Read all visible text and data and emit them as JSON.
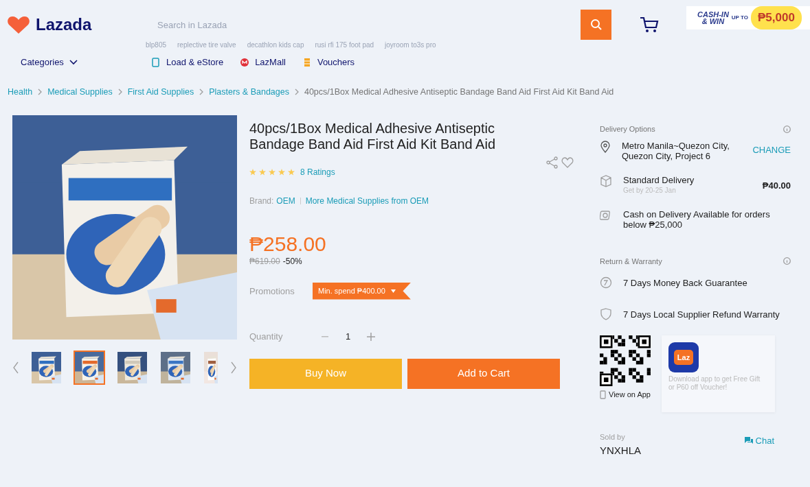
{
  "header": {
    "logo": "Lazada",
    "search": {
      "placeholder": "Search in Lazada"
    },
    "suggestions": [
      "blp805",
      "replective tire valve",
      "decathlon kids cap",
      "rusi rfi 175 foot pad",
      "joyroom to3s pro"
    ],
    "promo": {
      "line1": "CASH-IN",
      "line2": "& WIN",
      "up_to": "UP TO",
      "amount": "₱5,000"
    }
  },
  "nav": {
    "categories": "Categories",
    "links": [
      {
        "label": "Load & eStore",
        "kind": "load"
      },
      {
        "label": "LazMall",
        "kind": "mall"
      },
      {
        "label": "Vouchers",
        "kind": "voucher"
      }
    ]
  },
  "breadcrumb": [
    {
      "label": "Health",
      "link": true
    },
    {
      "label": "Medical Supplies",
      "link": true
    },
    {
      "label": "First Aid Supplies",
      "link": true
    },
    {
      "label": "Plasters & Bandages",
      "link": true
    },
    {
      "label": "40pcs/1Box Medical Adhesive Antiseptic Bandage Band Aid First Aid Kit Band Aid",
      "link": false
    }
  ],
  "gallery": {
    "thumbnails": [
      {
        "selected": false
      },
      {
        "selected": true
      },
      {
        "selected": false
      },
      {
        "selected": false
      },
      {
        "selected": false
      }
    ]
  },
  "product": {
    "title": "40pcs/1Box Medical Adhesive Antiseptic Bandage Band Aid First Aid Kit Band Aid",
    "stars": 5,
    "ratings": "8 Ratings",
    "brand_label": "Brand:",
    "brand": "OEM",
    "more_link": "More Medical Supplies from OEM",
    "price": "₱258.00",
    "original_price": "₱619.00",
    "discount": "-50%",
    "promotions_label": "Promotions",
    "promotion": "Min. spend ₱400.00",
    "quantity_label": "Quantity",
    "quantity": "1",
    "buttons": [
      {
        "label": "Buy Now",
        "kind": "buy"
      },
      {
        "label": "Add to Cart",
        "kind": "cart"
      }
    ]
  },
  "delivery": {
    "title": "Delivery Options",
    "address": "Metro Manila~Quezon City, Quezon City, Project 6",
    "change": "CHANGE",
    "options": [
      {
        "kind": "standard",
        "title": "Standard Delivery",
        "subtitle": "Get by 20-25 Jan",
        "price": "₱40.00"
      },
      {
        "kind": "cod",
        "title": "Cash on Delivery Available for orders below ₱25,000"
      }
    ]
  },
  "warranty": {
    "title": "Return & Warranty",
    "items": [
      {
        "kind": "return",
        "label": "7 Days Money Back Guarantee"
      },
      {
        "kind": "warranty",
        "label": "7 Days Local Supplier Refund Warranty"
      }
    ]
  },
  "app": {
    "view_on_app": "View on App",
    "icon_label": "Laz",
    "promo": "Download app to get Free Gift or P60 off Voucher!"
  },
  "seller": {
    "label": "Sold by",
    "name": "YNXHLA",
    "chat": "Chat"
  }
}
